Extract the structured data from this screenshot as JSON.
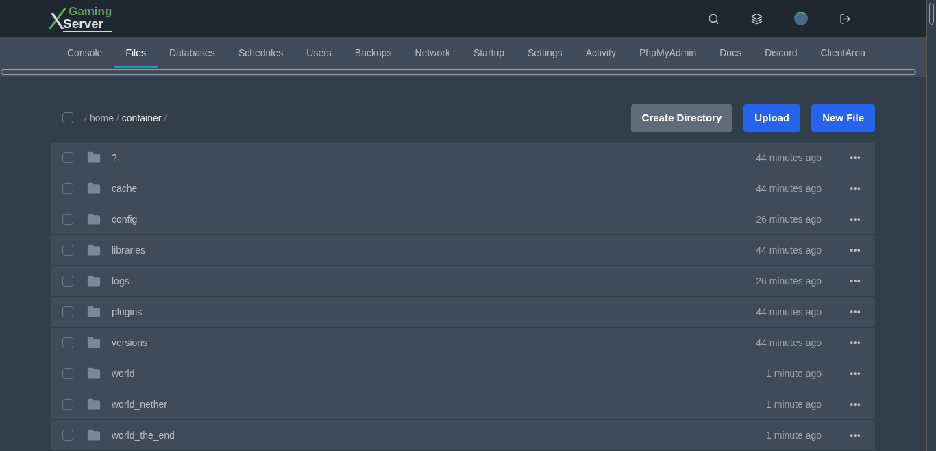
{
  "logo": {
    "line_1": "Gaming",
    "line_2": "Server"
  },
  "tabs": [
    {
      "label": "Console",
      "selected": false
    },
    {
      "label": "Files",
      "selected": true
    },
    {
      "label": "Databases",
      "selected": false
    },
    {
      "label": "Schedules",
      "selected": false
    },
    {
      "label": "Users",
      "selected": false
    },
    {
      "label": "Backups",
      "selected": false
    },
    {
      "label": "Network",
      "selected": false
    },
    {
      "label": "Startup",
      "selected": false
    },
    {
      "label": "Settings",
      "selected": false
    },
    {
      "label": "Activity",
      "selected": false
    },
    {
      "label": "PhpMyAdmin",
      "selected": false
    },
    {
      "label": "Docs",
      "selected": false
    },
    {
      "label": "Discord",
      "selected": false
    },
    {
      "label": "ClientArea",
      "selected": false
    }
  ],
  "breadcrumb": {
    "separator": "/",
    "parts": [
      "home",
      "container"
    ],
    "select_all_checked": false
  },
  "buttons": [
    {
      "label": "Create Directory",
      "kind": "secondary"
    },
    {
      "label": "Upload",
      "kind": "primary"
    },
    {
      "label": "New File",
      "kind": "primary"
    }
  ],
  "files": [
    {
      "name": "?",
      "modified": "44 minutes ago",
      "checked": false
    },
    {
      "name": "cache",
      "modified": "44 minutes ago",
      "checked": false
    },
    {
      "name": "config",
      "modified": "26 minutes ago",
      "checked": false
    },
    {
      "name": "libraries",
      "modified": "44 minutes ago",
      "checked": false
    },
    {
      "name": "logs",
      "modified": "26 minutes ago",
      "checked": false
    },
    {
      "name": "plugins",
      "modified": "44 minutes ago",
      "checked": false
    },
    {
      "name": "versions",
      "modified": "44 minutes ago",
      "checked": false
    },
    {
      "name": "world",
      "modified": "1 minute ago",
      "checked": false
    },
    {
      "name": "world_nether",
      "modified": "1 minute ago",
      "checked": false
    },
    {
      "name": "world_the_end",
      "modified": "1 minute ago",
      "checked": false
    }
  ]
}
